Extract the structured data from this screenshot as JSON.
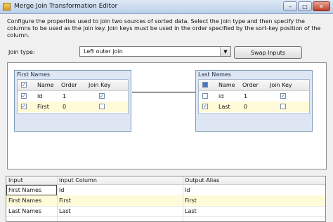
{
  "window": {
    "title": "Merge Join Transformation Editor"
  },
  "description": "Configure the properties used to join two sources of sorted data. Select the join type and then specify the columns to be used as the join key. Join keys must be used in the order specified by the sort-key position of the column.",
  "join_type": {
    "label": "Join type:",
    "value": "Left outer join"
  },
  "swap_inputs_label": "Swap Inputs",
  "left_table": {
    "title": "First Names",
    "headers": {
      "name": "Name",
      "order": "Order",
      "key": "Join Key"
    },
    "rows": [
      {
        "name": "Id",
        "order": "1",
        "selected": true,
        "key": true
      },
      {
        "name": "First",
        "order": "0",
        "selected": true,
        "key": false
      }
    ]
  },
  "right_table": {
    "title": "Last Names",
    "headers": {
      "name": "Name",
      "order": "Order",
      "key": "Join Key"
    },
    "rows": [
      {
        "name": "id",
        "order": "1",
        "selected": false,
        "key": true
      },
      {
        "name": "Last",
        "order": "0",
        "selected": true,
        "key": false
      }
    ]
  },
  "output_grid": {
    "headers": [
      "Input",
      "Input Column",
      "Output Alias"
    ],
    "rows": [
      [
        "First Names",
        "Id",
        "Id"
      ],
      [
        "First Names",
        "First",
        "First"
      ],
      [
        "Last Names",
        "Last",
        "Last"
      ]
    ]
  },
  "icons": {
    "minimize": "minimize-icon",
    "maximize": "maximize-icon",
    "close": "close-icon",
    "dropdown": "chevron-down-icon"
  },
  "colors": {
    "selected_row": "#fffbd8",
    "titlebar": "#bcd0ea",
    "table_header": "#dde6f2"
  }
}
